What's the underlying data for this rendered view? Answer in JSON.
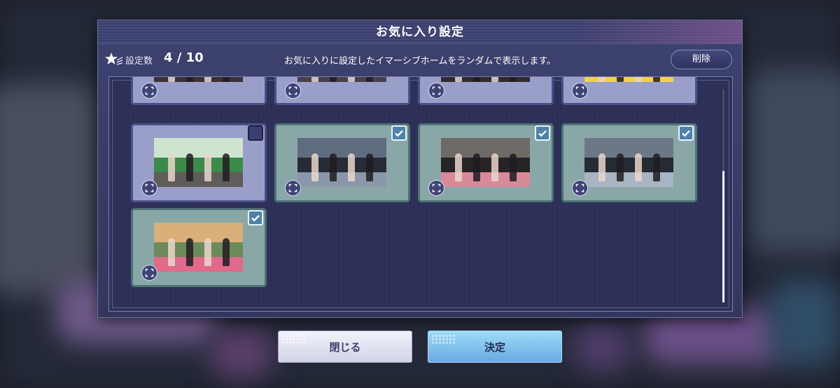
{
  "dialog": {
    "title": "お気に入り設定",
    "count_label": "設定数",
    "count_value": "4 / 10",
    "description": "お気に入りに設定したイマーシブホームをランダムで表示します。",
    "delete_label": "削除"
  },
  "cards": [
    {
      "checked": false,
      "partial": true,
      "scene": "room-red"
    },
    {
      "checked": false,
      "partial": true,
      "scene": "room-red-sofa"
    },
    {
      "checked": false,
      "partial": true,
      "scene": "room-studio"
    },
    {
      "checked": false,
      "partial": true,
      "scene": "room-colorful"
    },
    {
      "checked": false,
      "partial": false,
      "scene": "green-cafe"
    },
    {
      "checked": true,
      "partial": false,
      "scene": "stage-band"
    },
    {
      "checked": true,
      "partial": false,
      "scene": "stage-group"
    },
    {
      "checked": true,
      "partial": false,
      "scene": "stage-solo"
    },
    {
      "checked": true,
      "partial": false,
      "scene": "warm-room"
    }
  ],
  "footer": {
    "close_label": "閉じる",
    "decide_label": "決定"
  },
  "colors": {
    "dialog_bg": "#363a63",
    "checked_card": "#8aa7a8",
    "unchecked_card": "#9a9fc9",
    "decide_button": "#7fc2ec"
  }
}
